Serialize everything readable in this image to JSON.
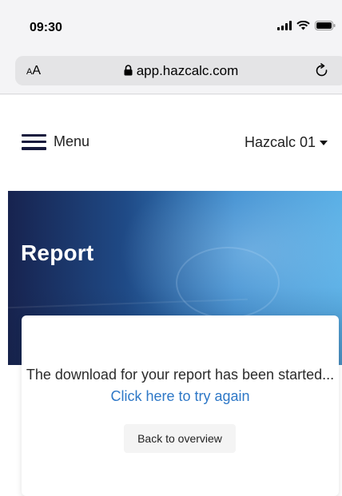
{
  "status_bar": {
    "time": "09:30",
    "icons": [
      "signal-icon",
      "wifi-icon",
      "battery-icon"
    ]
  },
  "address_bar": {
    "text_size_small": "A",
    "text_size_large": "A",
    "url": "app.hazcalc.com",
    "icons": [
      "lock-icon",
      "reload-icon"
    ]
  },
  "nav": {
    "menu_label": "Menu",
    "account_label": "Hazcalc 01",
    "icons": [
      "hamburger-icon",
      "caret-down-icon"
    ]
  },
  "hero": {
    "title": "Report"
  },
  "card": {
    "message": "The download for your report has been started...",
    "retry_link": "Click here to try again",
    "back_button": "Back to overview"
  },
  "colors": {
    "brand_navy": "#161a3d",
    "link_blue": "#2e78c7",
    "hero_start": "#17234f",
    "hero_end": "#5ab0e6"
  }
}
